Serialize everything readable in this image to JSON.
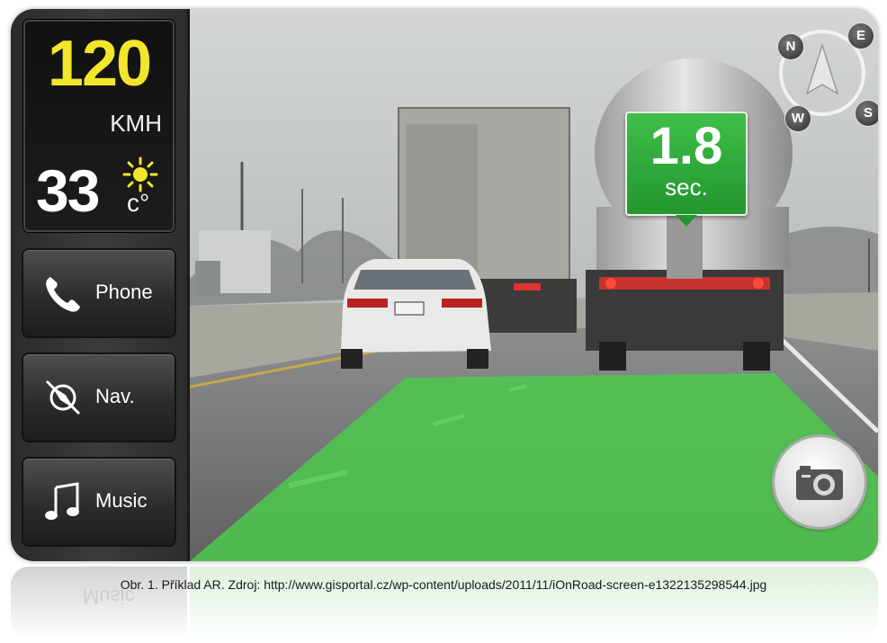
{
  "dashboard": {
    "speed": "120",
    "speed_unit": "KMH",
    "temperature": "33",
    "temperature_unit": "c°",
    "weather_icon": "sun-icon"
  },
  "buttons": [
    {
      "label": "Phone",
      "icon": "phone-icon"
    },
    {
      "label": "Nav.",
      "icon": "navigation-icon"
    },
    {
      "label": "Music",
      "icon": "music-note-icon"
    }
  ],
  "distance_indicator": {
    "value": "1.8",
    "unit": "sec."
  },
  "compass": {
    "north": "N",
    "east": "E",
    "west": "W",
    "south": "S",
    "icon": "compass-arrow-icon"
  },
  "camera": {
    "icon": "camera-icon"
  },
  "colors": {
    "speed_text": "#f2e62a",
    "lane_overlay": "#4cc94c",
    "badge_green": "#2ea53a"
  },
  "caption": "Obr. 1. Příklad AR. Zdroj: http://www.gisportal.cz/wp-content/uploads/2011/11/iOnRoad-screen-e1322135298544.jpg",
  "reflection_label": "Music"
}
